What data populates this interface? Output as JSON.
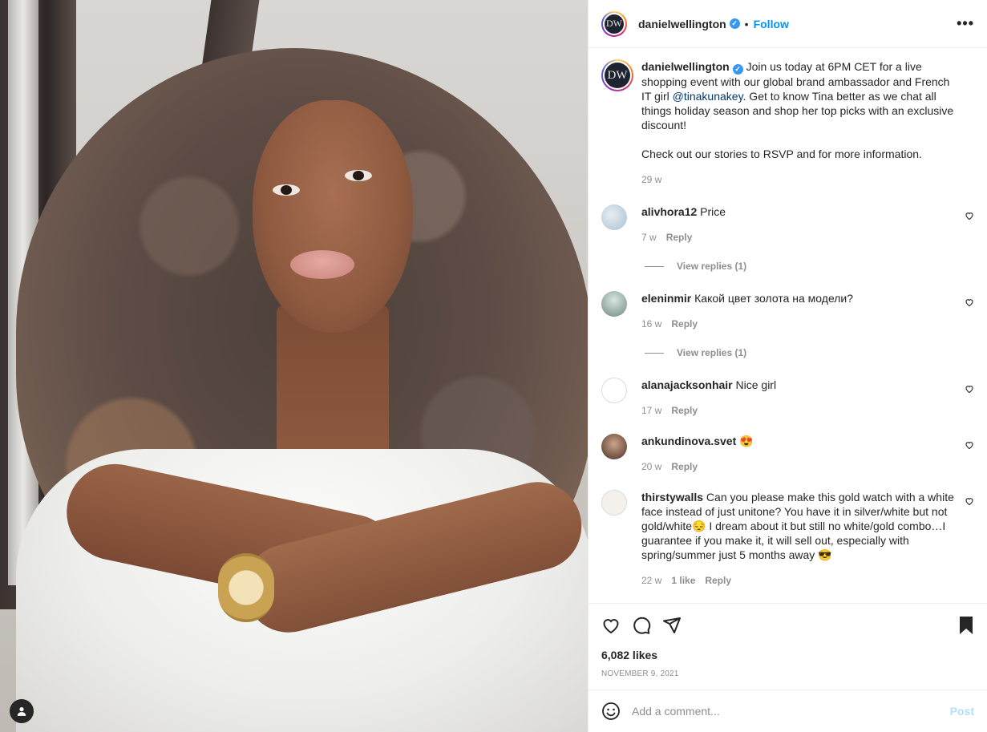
{
  "post": {
    "username": "danielwellington",
    "follow_label": "Follow",
    "dot": "•",
    "more_label": "•••",
    "avatar_text": "DW"
  },
  "caption": {
    "username": "danielwellington",
    "text_before": "Join us today at 6PM CET for a live shopping event with our global brand ambassador and French IT girl ",
    "mention": "@tinakunakey",
    "text_after": ". Get to know Tina better as we chat all things holiday season and shop her top picks with an exclusive discount!",
    "text_p2": "Check out our stories to RSVP and for more information.",
    "age": "29 w"
  },
  "comments": [
    {
      "username": "alivhora12",
      "text": "Price",
      "age": "7 w",
      "reply_label": "Reply",
      "view_replies": "View replies (1)",
      "avatar_color": "#c9d6e3"
    },
    {
      "username": "eleninmir",
      "text": "Какой цвет золота на модели?",
      "age": "16 w",
      "reply_label": "Reply",
      "view_replies": "View replies (1)",
      "avatar_color": "#8aa7a0"
    },
    {
      "username": "alanajacksonhair",
      "text": "Nice girl",
      "age": "17 w",
      "reply_label": "Reply",
      "avatar_color": "#ffffff"
    },
    {
      "username": "ankundinova.svet",
      "text": "😍",
      "age": "20 w",
      "reply_label": "Reply",
      "avatar_color": "#6b4a3a"
    },
    {
      "username": "thirstywalls",
      "text": "Can you please make this gold watch with a white face instead of just unitone? You have it in silver/white but not gold/white😔 I dream about it but still no white/gold combo…I guarantee if you make it, it will sell out, especially with spring/summer just 5 months away 😎",
      "age": "22 w",
      "likes_label": "1 like",
      "reply_label": "Reply",
      "avatar_color": "#f4f1ec"
    }
  ],
  "footer": {
    "likes": "6,082 likes",
    "date": "NOVEMBER 9, 2021",
    "add_comment_placeholder": "Add a comment...",
    "post_label": "Post"
  },
  "colors": {
    "accent": "#0095f6",
    "verified": "#3897f0",
    "muted": "#8e8e8e",
    "post_disabled": "#b2dffc"
  },
  "icons": [
    "heart-icon",
    "comment-icon",
    "share-icon",
    "bookmark-icon",
    "emoji-icon",
    "account-icon",
    "verified-icon"
  ]
}
